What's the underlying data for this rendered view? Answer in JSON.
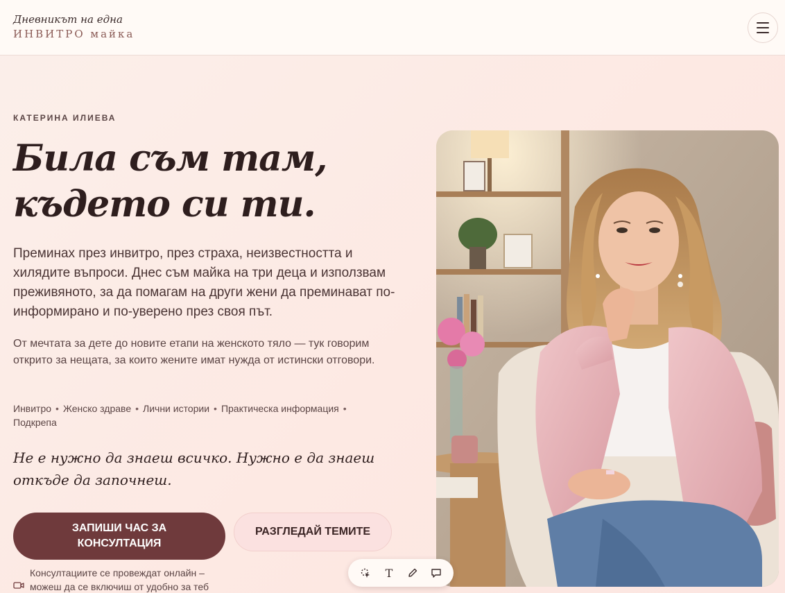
{
  "header": {
    "logo_line1": "Дневникът на една",
    "logo_line2": "ИНВИТРО майка",
    "menu_icon": "hamburger-icon"
  },
  "hero": {
    "eyebrow": "КАТЕРИНА ИЛИЕВА",
    "headline": "Била съм там, където си ти.",
    "lead": "Преминах през инвитро, през страха, неизвестността и хилядите въпроси. Днес съм майка на три деца и използвам преживяното, за да помагам на други жени да преминават по-информирано и по-уверено през своя път.",
    "sub": "От мечтата за дете до новите етапи на женското тяло — тук говорим открито за нещата, за които жените имат нужда от истински отговори.",
    "tags": [
      "Инвитро",
      "Женско здраве",
      "Лични истории",
      "Практическа информация",
      "Подкрепа"
    ],
    "quote": "Не е нужно да знаеш всичко. Нужно е да знаеш откъде да започнеш.",
    "primary_button": "ЗАПИШИ ЧАС ЗА КОНСУЛТАЦИЯ",
    "secondary_button": "РАЗГЛЕДАЙ ТЕМИТЕ",
    "note": "Консултациите се провеждат онлайн – можеш да се включиш от удобно за теб",
    "note_icon": "video-camera-icon"
  },
  "photo": {
    "alt": "portrait-photo"
  },
  "toolbar": {
    "tools": [
      "select-icon",
      "text-icon",
      "pen-icon",
      "comment-icon"
    ],
    "text_tool_glyph": "T"
  },
  "colors": {
    "accent": "#6f3a3c",
    "secondary_button_bg": "#fbe1e0",
    "background": "#fbefea",
    "jacket_pink": "#e7b3b8"
  }
}
